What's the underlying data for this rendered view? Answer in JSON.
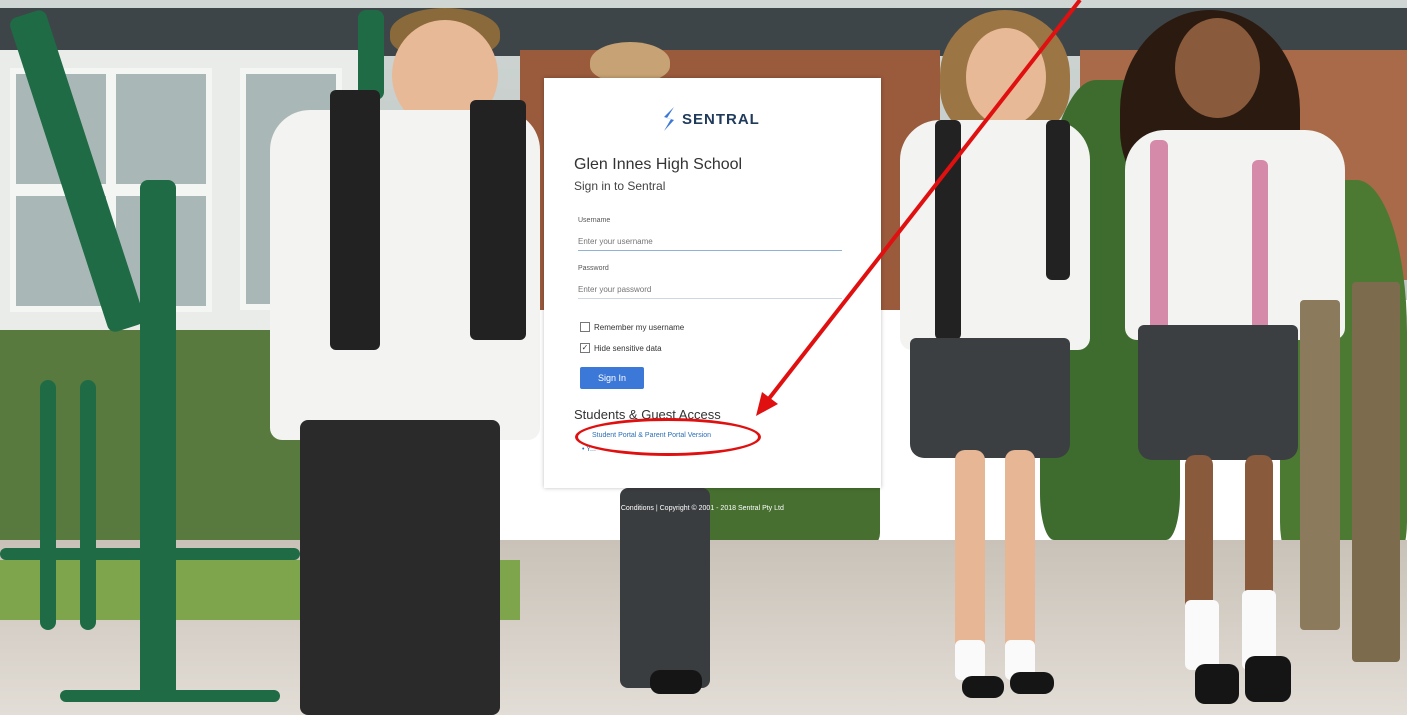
{
  "brand": {
    "name": "SENTRAL",
    "logo_icon": "sentral-s-logo",
    "color": "#3b78d8"
  },
  "login": {
    "school_name": "Glen Innes High School",
    "subtitle": "Sign in to Sentral",
    "username_label": "Username",
    "username_placeholder": "Enter your username",
    "password_label": "Password",
    "password_placeholder": "Enter your password",
    "remember_label": "Remember my username",
    "remember_checked": false,
    "hide_label": "Hide sensitive data",
    "hide_checked": true,
    "signin_label": "Sign In"
  },
  "guest": {
    "heading": "Students & Guest Access",
    "portal_link": "Student Portal & Parent Portal Version",
    "bullet_link": "Y..."
  },
  "footer": {
    "text": "Terms & Conditions | Copyright © 2001 - 2018 Sentral Pty Ltd",
    "icon": "info-icon"
  },
  "annotation": {
    "color": "#e01010"
  }
}
